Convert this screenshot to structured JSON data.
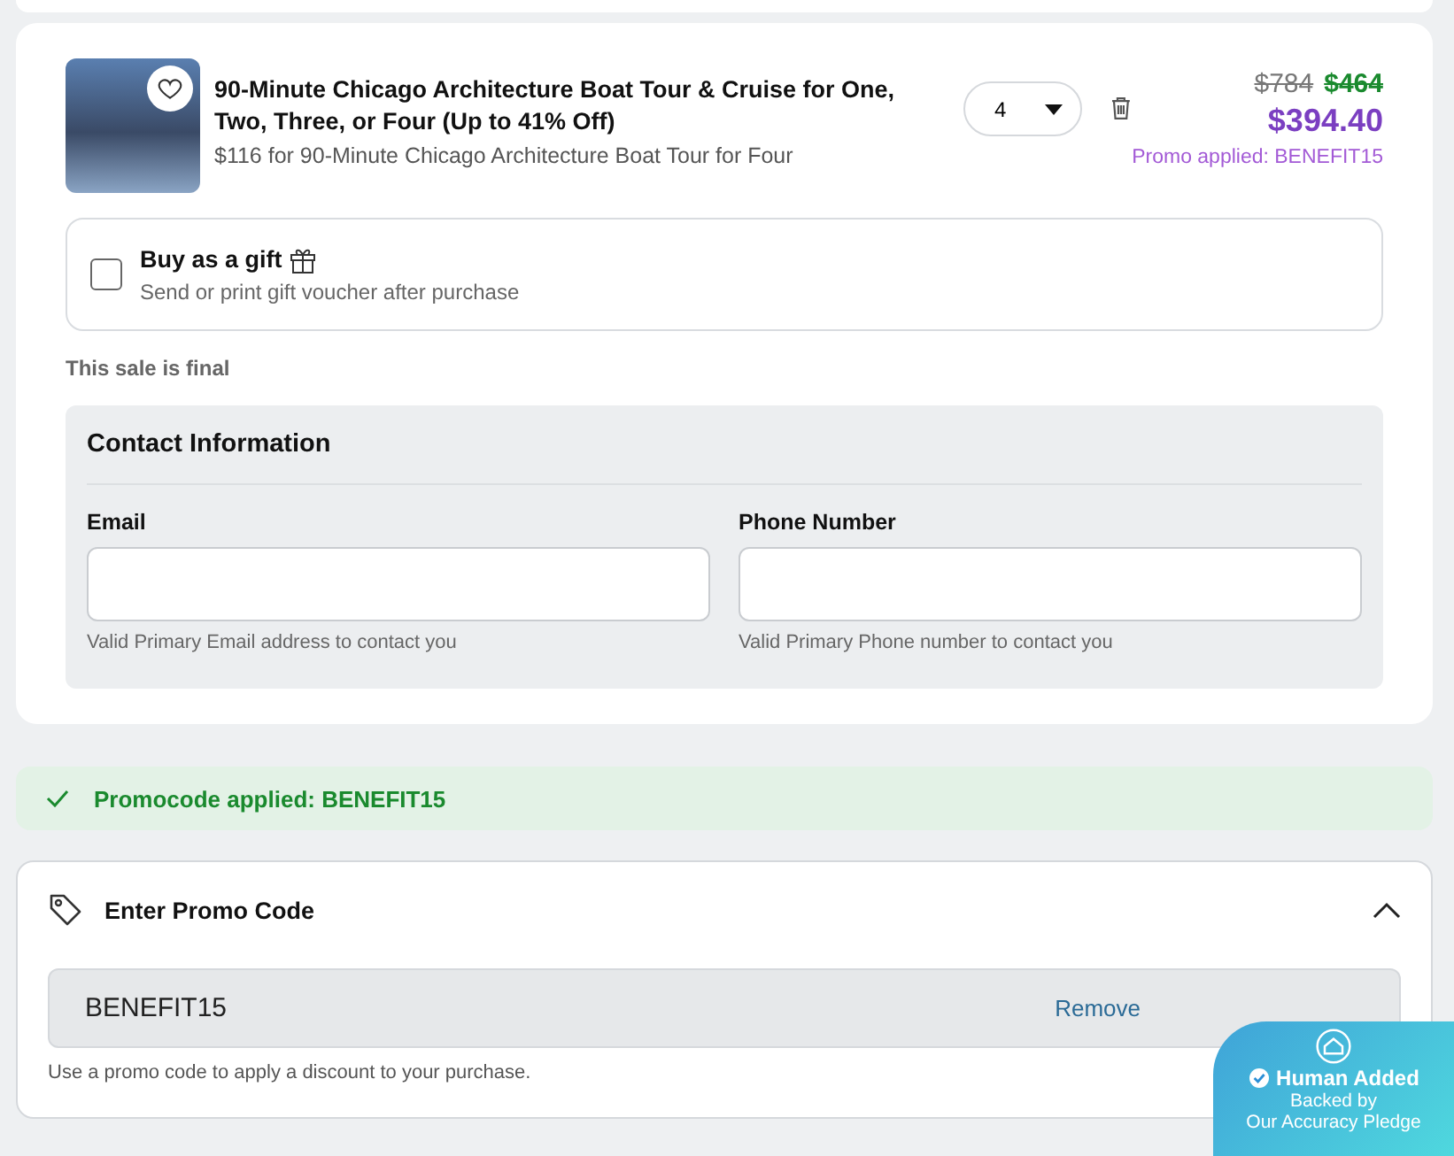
{
  "product": {
    "title": "90-Minute Chicago Architecture Boat Tour & Cruise for One, Two, Three, or Four (Up to 41% Off)",
    "subtitle": "$116 for 90-Minute Chicago Architecture Boat Tour for Four",
    "favorited": false,
    "quantity": "4",
    "original_price": "$784",
    "discount_price": "$464",
    "final_price": "$394.40",
    "promo_note": "Promo applied: BENEFIT15"
  },
  "gift": {
    "label": "Buy as a gift",
    "hint": "Send or print gift voucher after purchase",
    "checked": false
  },
  "sale_note": "This sale is final",
  "contact": {
    "title": "Contact Information",
    "fields": [
      {
        "label": "Email",
        "hint": "Valid Primary Email address to contact you"
      },
      {
        "label": "Phone Number",
        "hint": "Valid Primary Phone number to contact you"
      }
    ]
  },
  "promo_banner": "Promocode applied: BENEFIT15",
  "promo": {
    "title": "Enter Promo Code",
    "expanded": true,
    "code": "BENEFIT15",
    "button": "Remove",
    "hint": "Use a promo code to apply a discount to your purchase."
  },
  "badge": {
    "title": "Human Added",
    "line_1": "Backed by",
    "line_2": "Our Accuracy Pledge"
  }
}
